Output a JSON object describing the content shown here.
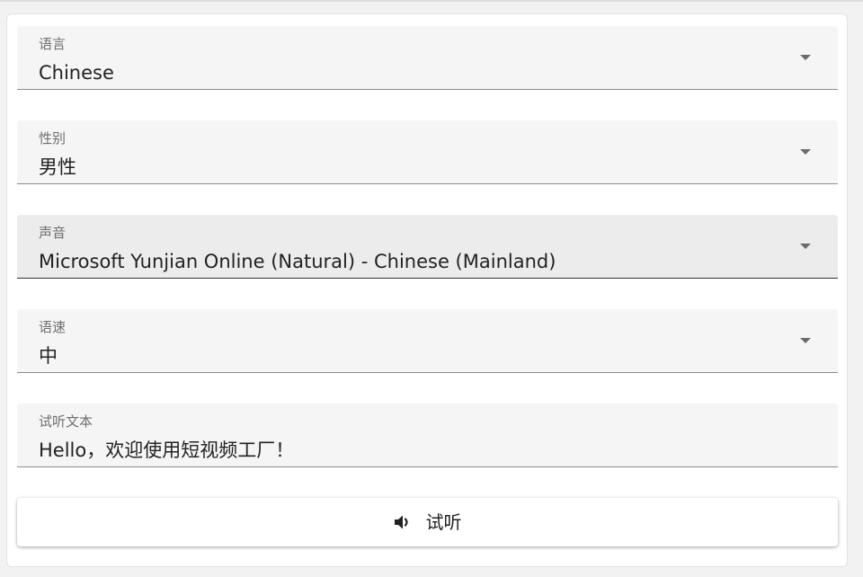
{
  "form": {
    "language": {
      "label": "语言",
      "value": "Chinese"
    },
    "gender": {
      "label": "性别",
      "value": "男性"
    },
    "voice": {
      "label": "声音",
      "value": "Microsoft Yunjian Online (Natural) - Chinese (Mainland)"
    },
    "speed": {
      "label": "语速",
      "value": "中"
    },
    "preview_text": {
      "label": "试听文本",
      "value": "Hello，欢迎使用短视频工厂！"
    }
  },
  "listen_button": {
    "label": "试听",
    "icon": "speaker-icon"
  }
}
